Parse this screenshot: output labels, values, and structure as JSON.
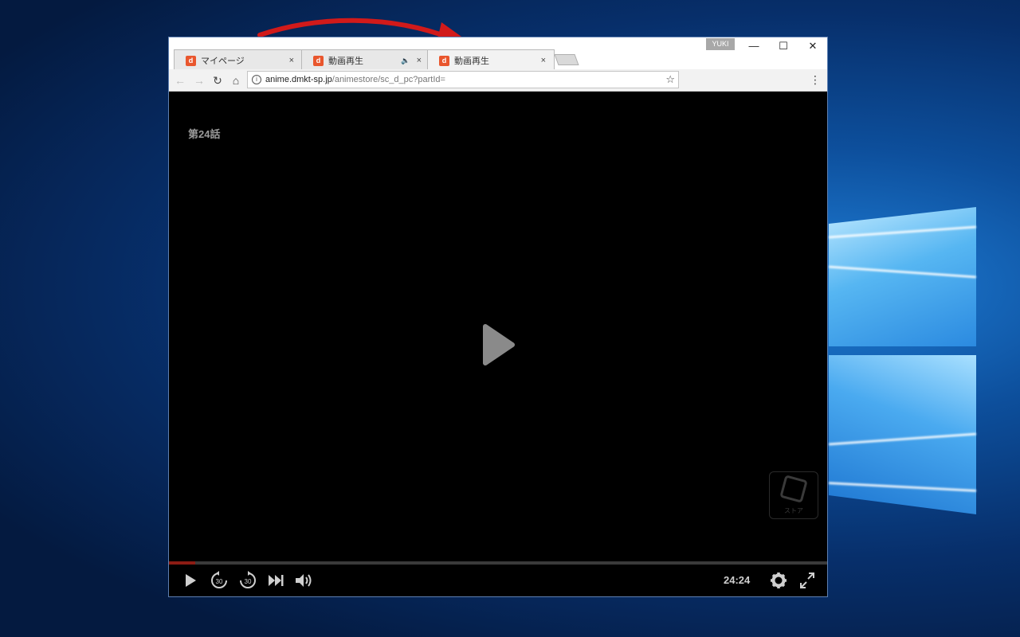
{
  "browser": {
    "profile_name": "YUKI",
    "tabs": [
      {
        "title": "マイページ",
        "favicon": "d",
        "close": "×"
      },
      {
        "title": "動画再生",
        "favicon": "d",
        "audio": "🔈",
        "close": "×"
      },
      {
        "title": "動画再生",
        "favicon": "d",
        "close": "×",
        "active": true
      }
    ],
    "window_buttons": {
      "minimize": "—",
      "maximize": "☐",
      "close": "✕"
    },
    "nav": {
      "back": "←",
      "forward": "→",
      "reload": "↻",
      "home": "⌂"
    },
    "omnibox": {
      "url_host": "anime.dmkt-sp.jp",
      "url_path": "/animestore/sc_d_pc?partId=",
      "star": "☆",
      "info": "i"
    },
    "menu": "⋮"
  },
  "player": {
    "episode_title": "第24話",
    "duration": "24:24",
    "progress_fraction": 0.04,
    "watermark_text": "ストア",
    "controls": {
      "play": "play-icon",
      "rewind": "30",
      "forward": "30",
      "next": "next-icon",
      "volume": "volume-icon",
      "settings": "gear-icon",
      "fullscreen": "fullscreen-icon"
    }
  },
  "colors": {
    "arrow": "#d11a1a",
    "progress": "#8c1c14",
    "favicon": "#e9562d"
  }
}
